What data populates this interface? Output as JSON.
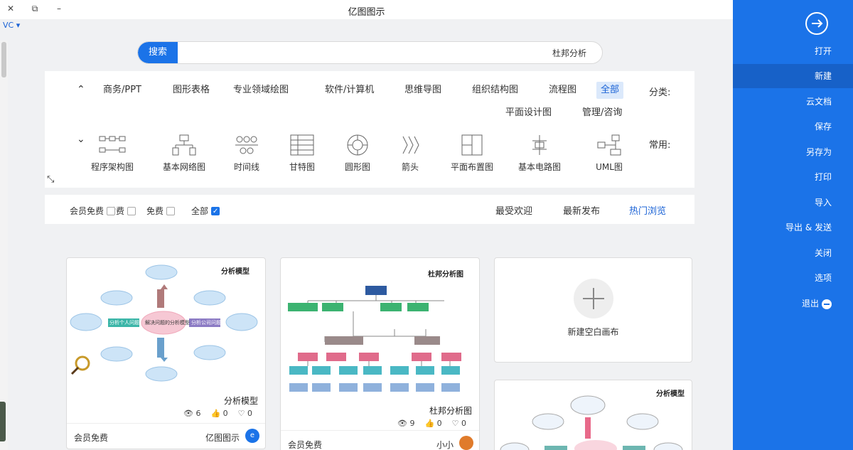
{
  "window": {
    "title": "亿图图示",
    "minimize": "–",
    "restore": "⧉",
    "close": "✕",
    "vc_label": "VC ▾"
  },
  "search": {
    "button": "搜索",
    "value": "杜邦分析"
  },
  "categories": {
    "label": "分类:",
    "items": [
      "全部",
      "流程图",
      "组织结构图",
      "思维导图",
      "软件/计算机",
      "专业领域绘图",
      "图形表格",
      "商务/PPT"
    ],
    "items_row2": [
      "管理/咨询",
      "平面设计图"
    ],
    "active": "全部",
    "collapse_icon": "⌃"
  },
  "common": {
    "label": "常用:",
    "expand_icon": "⌄",
    "templates": [
      "UML图",
      "基本电路图",
      "平面布置图",
      "箭头",
      "圆形图",
      "甘特图",
      "时间线",
      "基本网络图",
      "程序架构图"
    ]
  },
  "filter": {
    "tabs": [
      "热门浏览",
      "最新发布",
      "最受欢迎"
    ],
    "active_tab": "热门浏览",
    "checks": [
      {
        "label": "全部",
        "checked": true
      },
      {
        "label": "免费",
        "checked": false
      },
      {
        "label": "付费",
        "checked": false
      },
      {
        "label": "会员免费",
        "checked": false
      }
    ]
  },
  "cards": {
    "new_canvas": "新建空白画布",
    "card1": {
      "preview_title": "分析模型",
      "name": "分析模型",
      "views": "6",
      "likes": "0",
      "favs": "0",
      "author": "亿图图示",
      "price": "会员免费",
      "center_label": "解决问题的分析模型",
      "right_label": "分析个人问题",
      "left_label": "分析公司问题"
    },
    "card2": {
      "preview_title": "杜邦分析图",
      "name": "杜邦分析图",
      "views": "9",
      "likes": "0",
      "favs": "0",
      "author": "小小",
      "price": "会员免费"
    },
    "card3": {
      "preview_title": "分析模型"
    }
  },
  "sidebar": {
    "items": [
      "打开",
      "新建",
      "云文档",
      "保存",
      "另存为",
      "打印",
      "导入",
      "导出 & 发送",
      "关闭",
      "选项",
      "退出"
    ],
    "active": "新建"
  },
  "colors": {
    "accent": "#1b73e8",
    "sidebar_active": "#1761c8",
    "pink": "#e86a8a",
    "teal": "#4ab8c4",
    "green": "#3cb371",
    "navy": "#2d5aa0"
  }
}
